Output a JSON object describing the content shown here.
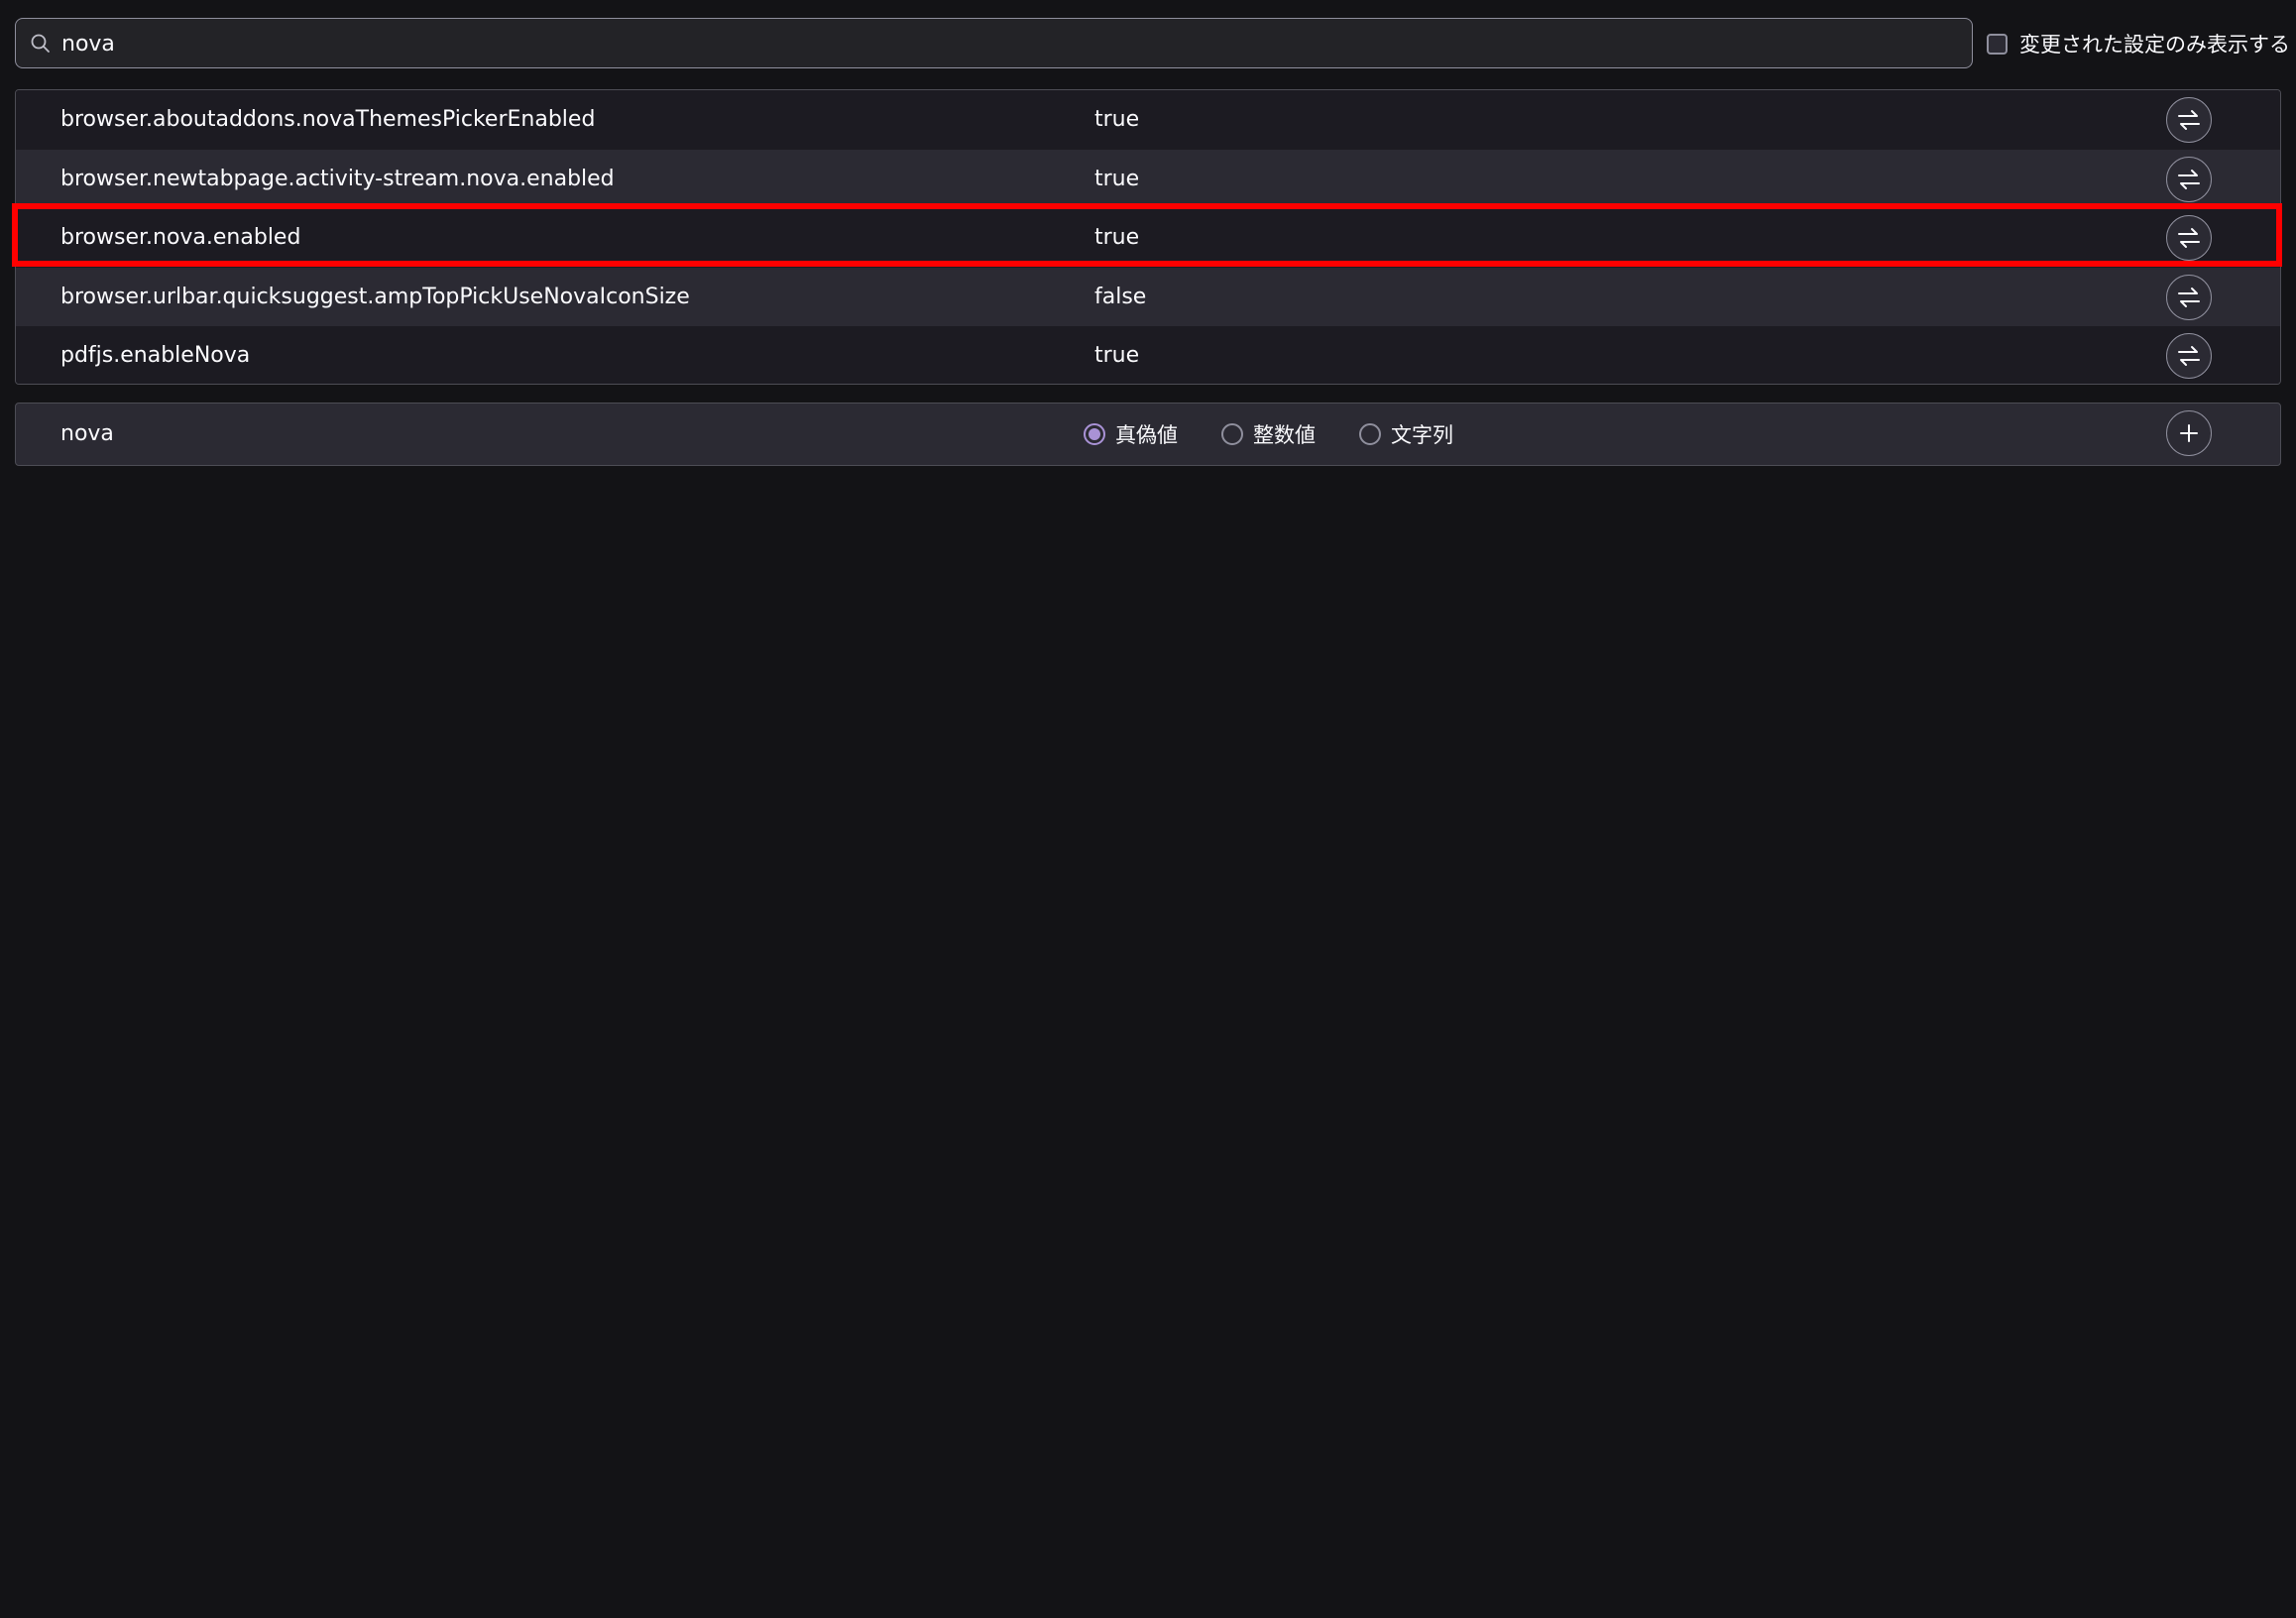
{
  "search": {
    "value": "nova",
    "icon": "search-icon"
  },
  "modified_only": {
    "label": "変更された設定のみ表示する",
    "checked": false
  },
  "prefs": [
    {
      "name": "browser.aboutaddons.novaThemesPickerEnabled",
      "value": "true"
    },
    {
      "name": "browser.newtabpage.activity-stream.nova.enabled",
      "value": "true"
    },
    {
      "name": "browser.nova.enabled",
      "value": "true",
      "highlighted": true
    },
    {
      "name": "browser.urlbar.quicksuggest.ampTopPickUseNovaIconSize",
      "value": "false"
    },
    {
      "name": "pdfjs.enableNova",
      "value": "true"
    }
  ],
  "add_pref": {
    "name": "nova",
    "types": [
      {
        "label": "真偽値",
        "checked": true
      },
      {
        "label": "整数値",
        "checked": false
      },
      {
        "label": "文字列",
        "checked": false
      }
    ]
  },
  "colors": {
    "background": "#131316",
    "row_odd": "#1c1b22",
    "row_even": "#2b2a33",
    "accent": "#a992d6",
    "highlight": "#ff0000"
  }
}
